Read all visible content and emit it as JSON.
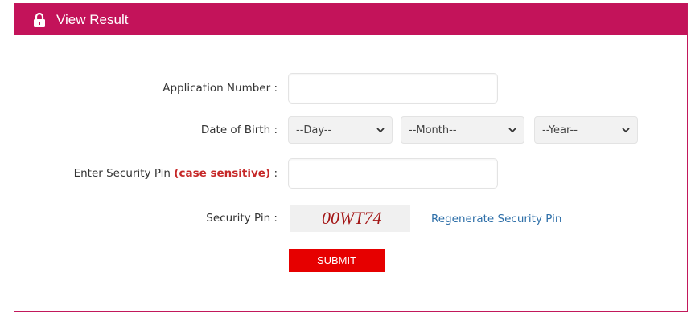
{
  "header": {
    "title": "View Result",
    "icon": "lock-icon",
    "color": "#c3135a"
  },
  "form": {
    "application_number": {
      "label": "Application Number :",
      "value": ""
    },
    "dob": {
      "label": "Date of Birth :",
      "day": "--Day--",
      "month": "--Month--",
      "year": "--Year--"
    },
    "security_pin_input": {
      "label_prefix": "Enter Security Pin",
      "label_highlight": "(case sensitive)",
      "label_suffix": ":",
      "value": ""
    },
    "security_pin": {
      "label": "Security Pin :",
      "captcha_text": "00WT74",
      "regenerate_label": "Regenerate Security Pin"
    },
    "submit_label": "SUBMIT"
  },
  "colors": {
    "accent": "#c3135a",
    "submit": "#e60000",
    "link": "#2e6fa8",
    "highlight": "#c62828"
  }
}
